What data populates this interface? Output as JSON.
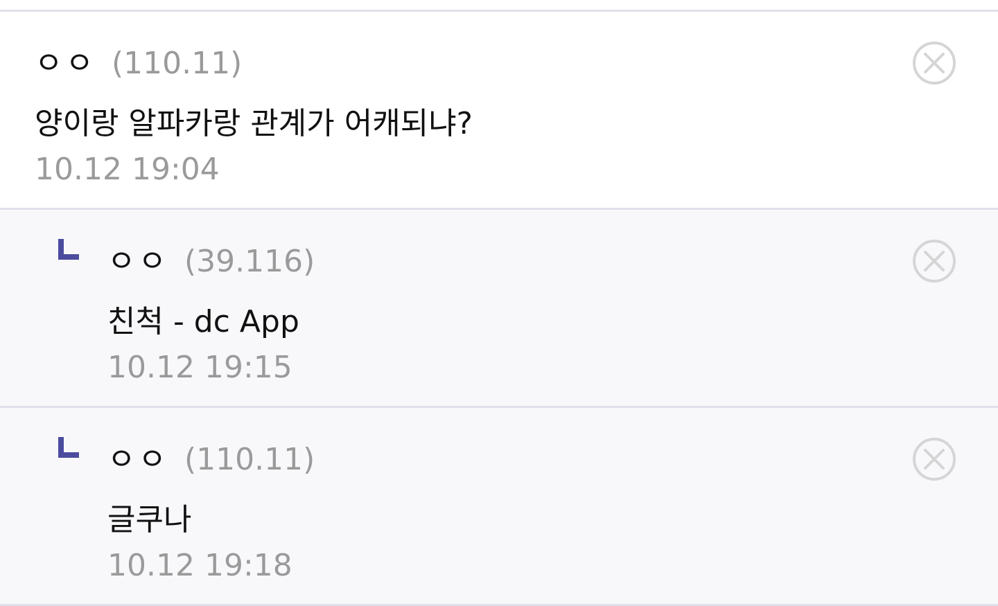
{
  "comments": [
    {
      "nickname": "ㅇㅇ",
      "ip": "(110.11)",
      "text": "양이랑 알파카랑 관계가 어캐되냐?",
      "time": "10.12 19:04",
      "delete_icon": "close-circle-icon"
    }
  ],
  "replies": [
    {
      "nickname": "ㅇㅇ",
      "ip": "(39.116)",
      "text": "친척 - dc App",
      "time": "10.12 19:15",
      "reply_icon": "reply-arrow-icon",
      "delete_icon": "close-circle-icon"
    },
    {
      "nickname": "ㅇㅇ",
      "ip": "(110.11)",
      "text": "글쿠나",
      "time": "10.12 19:18",
      "reply_icon": "reply-arrow-icon",
      "delete_icon": "close-circle-icon"
    }
  ],
  "colors": {
    "reply_mark": "#4b4c9e",
    "meta_text": "#9a9a9a",
    "divider": "#dfe0ea",
    "reply_bg": "#f8f8fb"
  }
}
